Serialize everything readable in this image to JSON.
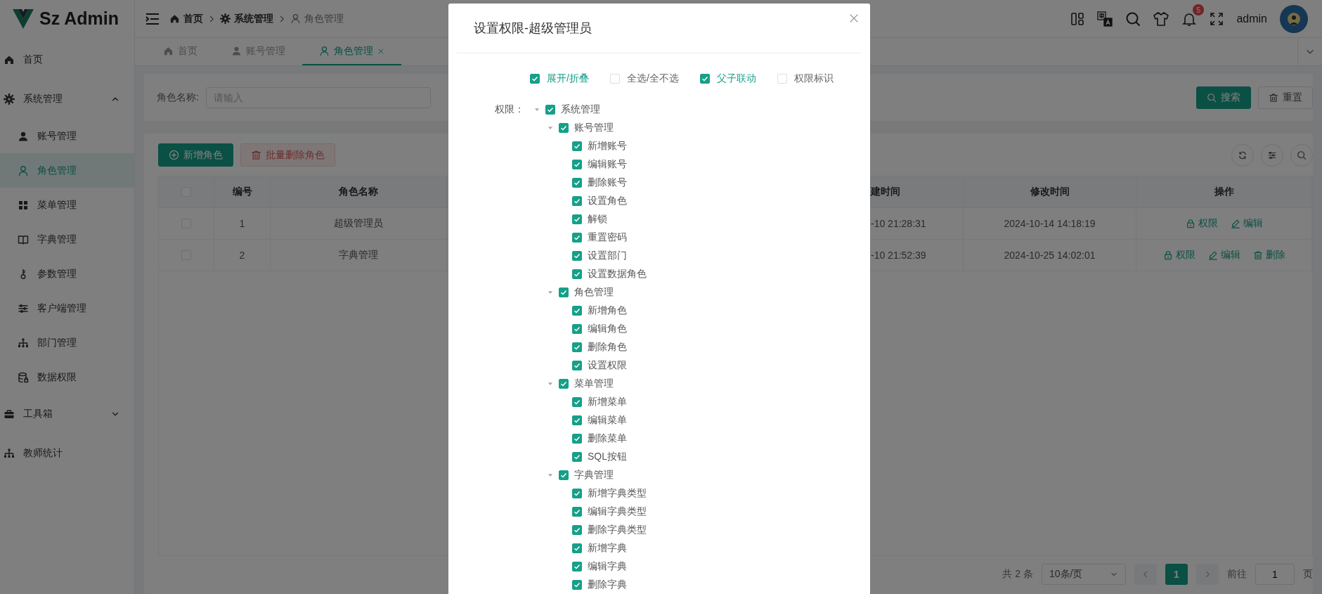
{
  "app": {
    "title": "Sz Admin"
  },
  "header": {
    "breadcrumb": [
      {
        "label": "首页"
      },
      {
        "label": "系统管理"
      },
      {
        "label": "角色管理"
      }
    ],
    "notification_count": "5",
    "user": "admin"
  },
  "sidebar": {
    "items": [
      {
        "label": "首页",
        "selected": false
      },
      {
        "label": "系统管理",
        "selected": false,
        "expanded": true,
        "children": [
          {
            "label": "账号管理",
            "selected": false
          },
          {
            "label": "角色管理",
            "selected": true
          },
          {
            "label": "菜单管理",
            "selected": false
          },
          {
            "label": "字典管理",
            "selected": false
          },
          {
            "label": "参数管理",
            "selected": false
          },
          {
            "label": "客户端管理",
            "selected": false
          },
          {
            "label": "部门管理",
            "selected": false
          },
          {
            "label": "数据权限",
            "selected": false
          }
        ]
      },
      {
        "label": "工具箱",
        "selected": false,
        "expanded": false
      },
      {
        "label": "教师统计",
        "selected": false
      }
    ]
  },
  "tabs": [
    {
      "label": "首页",
      "selected": false
    },
    {
      "label": "账号管理",
      "selected": false
    },
    {
      "label": "角色管理",
      "selected": true
    }
  ],
  "search": {
    "label": "角色名称:",
    "placeholder": "请输入",
    "buttons": [
      {
        "label": "搜索",
        "kind": "primary"
      },
      {
        "label": "重置",
        "kind": "reset"
      }
    ]
  },
  "toolbar": {
    "buttons": [
      {
        "label": "新增角色",
        "kind": "add",
        "disabled": false
      },
      {
        "label": "批量删除角色",
        "kind": "delete",
        "disabled": true
      }
    ]
  },
  "table": {
    "select_all_checked": false,
    "columns": [
      "编号",
      "角色名称",
      "建时间",
      "修改时间",
      "操作"
    ],
    "rows": [
      {
        "checked": false,
        "number": "1",
        "name": "超级管理员",
        "created": "-10 21:28:31",
        "modified": "2024-10-14 14:18:19",
        "actions": [
          {
            "label": "权限",
            "kind": "permission"
          },
          {
            "label": "编辑",
            "kind": "edit"
          }
        ]
      },
      {
        "checked": false,
        "number": "2",
        "name": "字典管理",
        "created": "-10 21:52:39",
        "modified": "2024-10-25 14:02:01",
        "actions": [
          {
            "label": "权限",
            "kind": "permission"
          },
          {
            "label": "编辑",
            "kind": "edit"
          },
          {
            "label": "删除",
            "kind": "delete"
          }
        ]
      }
    ]
  },
  "pagination": {
    "total": "共 2 条",
    "page_size": "10条/页",
    "pages": [
      {
        "label": "1",
        "selected": true
      }
    ],
    "goto_label": "前往",
    "goto_value": "1",
    "goto_suffix": "页"
  },
  "modal": {
    "title": "设置权限-超级管理员",
    "options": [
      {
        "label": "展开/折叠",
        "checked": true
      },
      {
        "label": "全选/全不选",
        "checked": false
      },
      {
        "label": "父子联动",
        "checked": true
      },
      {
        "label": "权限标识",
        "checked": false
      }
    ],
    "tree_label": "权限：",
    "tree": [
      {
        "label": "系统管理",
        "checked": true,
        "expanded": true,
        "children": [
          {
            "label": "账号管理",
            "checked": true,
            "expanded": true,
            "children": [
              {
                "label": "新增账号",
                "checked": true
              },
              {
                "label": "编辑账号",
                "checked": true
              },
              {
                "label": "删除账号",
                "checked": true
              },
              {
                "label": "设置角色",
                "checked": true
              },
              {
                "label": "解锁",
                "checked": true
              },
              {
                "label": "重置密码",
                "checked": true
              },
              {
                "label": "设置部门",
                "checked": true
              },
              {
                "label": "设置数据角色",
                "checked": true
              }
            ]
          },
          {
            "label": "角色管理",
            "checked": true,
            "expanded": true,
            "children": [
              {
                "label": "新增角色",
                "checked": true
              },
              {
                "label": "编辑角色",
                "checked": true
              },
              {
                "label": "删除角色",
                "checked": true
              },
              {
                "label": "设置权限",
                "checked": true
              }
            ]
          },
          {
            "label": "菜单管理",
            "checked": true,
            "expanded": true,
            "children": [
              {
                "label": "新增菜单",
                "checked": true
              },
              {
                "label": "编辑菜单",
                "checked": true
              },
              {
                "label": "删除菜单",
                "checked": true
              },
              {
                "label": "SQL按钮",
                "checked": true
              }
            ]
          },
          {
            "label": "字典管理",
            "checked": true,
            "expanded": true,
            "children": [
              {
                "label": "新增字典类型",
                "checked": true
              },
              {
                "label": "编辑字典类型",
                "checked": true
              },
              {
                "label": "删除字典类型",
                "checked": true
              },
              {
                "label": "新增字典",
                "checked": true
              },
              {
                "label": "编辑字典",
                "checked": true
              },
              {
                "label": "删除字典",
                "checked": true
              }
            ]
          }
        ]
      }
    ]
  }
}
